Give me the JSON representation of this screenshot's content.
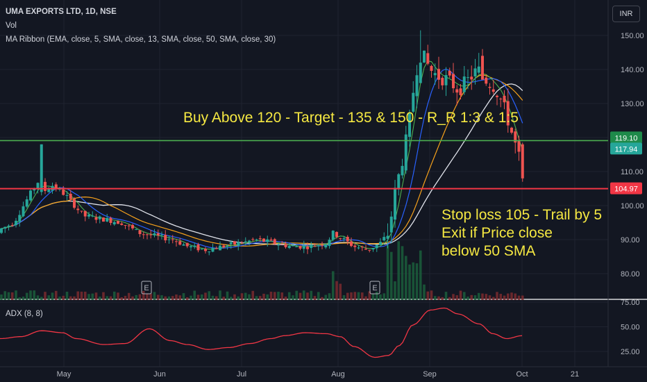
{
  "header": {
    "title": "UMA EXPORTS LTD, 1D, NSE",
    "vol_label": "Vol",
    "ma_label": "MA Ribbon (EMA, close, 5, SMA, close, 13, SMA, close, 50, SMA, close, 30)"
  },
  "currency_button": "INR",
  "annotations": {
    "buy": "Buy Above 120 - Target - 135 & 150 - R_R 1:3 & 1:5",
    "stop_lines": [
      "Stop loss 105 - Trail by 5",
      "Exit if Price close",
      "below 50 SMA"
    ]
  },
  "price_axis_labels": [
    "150.00",
    "140.00",
    "130.00",
    "110.00",
    "100.00",
    "90.00",
    "80.00"
  ],
  "adx_axis_labels": [
    "75.00",
    "50.00",
    "25.00"
  ],
  "time_axis_labels": [
    "May",
    "Jun",
    "Jul",
    "Aug",
    "Sep",
    "Oct",
    "21"
  ],
  "price_badges": {
    "green_line": "119.10",
    "last_price": "117.94",
    "red_line": "104.97"
  },
  "earnings_markers": [
    "E",
    "E"
  ],
  "adx_title": "ADX (8, 8)",
  "colors": {
    "background": "#131722",
    "up": "#26a69a",
    "down": "#ef5350",
    "green_line": "#4caf50",
    "red_line": "#f23645",
    "ema5": "#4caf50",
    "sma13": "#2962ff",
    "sma30": "#f7a21b",
    "sma50": "#e0e3eb",
    "adx": "#f23645",
    "annotation": "#f5e842"
  },
  "chart_data": {
    "type": "candlestick",
    "price_range": [
      76,
      155
    ],
    "horizontal_levels": {
      "green": 119.1,
      "red": 104.97
    },
    "last_close": 117.94,
    "adx_range": [
      15,
      78
    ],
    "grid": true
  }
}
